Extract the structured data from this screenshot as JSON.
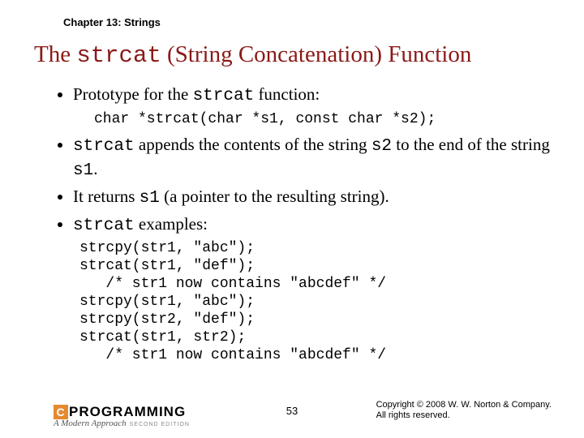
{
  "chapter": "Chapter 13: Strings",
  "title_pre": "The ",
  "title_code": "strcat",
  "title_post": " (String Concatenation) Function",
  "b1_pre": "Prototype for the ",
  "b1_code": "strcat",
  "b1_post": " function:",
  "prototype": "char *strcat(char *s1, const char *s2);",
  "b2_code1": "strcat",
  "b2_mid1": " appends the contents of the string ",
  "b2_code2": "s2",
  "b2_mid2": " to the end of the string ",
  "b2_code3": "s1",
  "b2_end": ".",
  "b3_pre": "It returns ",
  "b3_code": "s1",
  "b3_post": " (a pointer to the resulting string).",
  "b4_code": "strcat",
  "b4_post": " examples:",
  "example": "strcpy(str1, \"abc\");\nstrcat(str1, \"def\");\n   /* str1 now contains \"abcdef\" */\nstrcpy(str1, \"abc\");\nstrcpy(str2, \"def\");\nstrcat(str1, str2);\n   /* str1 now contains \"abcdef\" */",
  "logo_text": "PROGRAMMING",
  "logo_sub": "A Modern Approach",
  "logo_edition": "SECOND EDITION",
  "page": "53",
  "copyright1": "Copyright © 2008 W. W. Norton & Company.",
  "copyright2": "All rights reserved."
}
